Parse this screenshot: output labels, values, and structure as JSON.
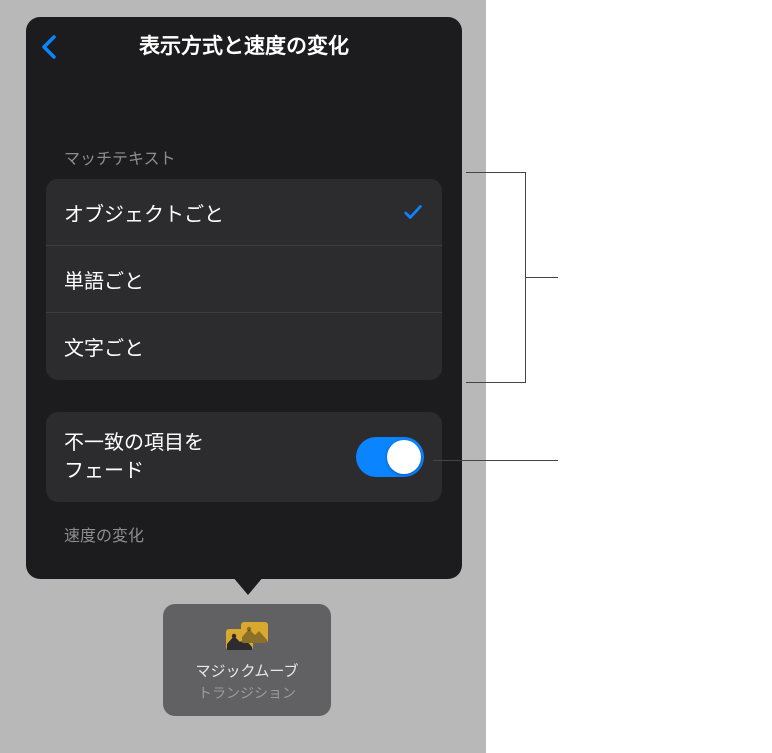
{
  "nav": {
    "title": "表示方式と速度の変化"
  },
  "sections": {
    "matchText": {
      "header": "マッチテキスト",
      "items": [
        {
          "label": "オブジェクトごと",
          "selected": true
        },
        {
          "label": "単語ごと",
          "selected": false
        },
        {
          "label": "文字ごと",
          "selected": false
        }
      ]
    },
    "fade": {
      "label": "不一致の項目を\nフェード",
      "enabled": true
    },
    "acceleration": {
      "header": "速度の変化"
    }
  },
  "chip": {
    "title": "マジックムーブ",
    "subtitle": "トランジション"
  }
}
